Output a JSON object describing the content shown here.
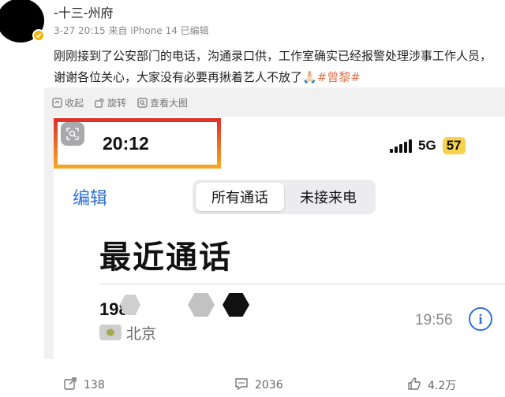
{
  "post": {
    "username": "-十三-州府",
    "meta": "3-27 20:15 来自 iPhone 14 已编辑",
    "text_main": "刚刚接到了公安部门的电话，沟通录口供，工作室确实已经报警处理涉事工作人员，谢谢各位关心，大家没有必要再揪着艺人不放了",
    "emoji": "🙏🏻",
    "hashtag": "#曾黎#"
  },
  "image_toolbar": {
    "collect": "收起",
    "rotate": "旋转",
    "view_large": "查看大图"
  },
  "phone": {
    "time": "20:12",
    "network": "5G",
    "battery": "57",
    "edit": "编辑",
    "segments": [
      "所有通话",
      "未接来电"
    ],
    "title": "最近通话",
    "call": {
      "number_prefix": "198",
      "location": "北京",
      "time": "19:56",
      "info_icon": "i"
    }
  },
  "actions": {
    "share_count": "138",
    "comment_count": "2036",
    "like_count": "4.2万"
  },
  "colors": {
    "accent_blue": "#2f6fd6",
    "hashtag": "#e8704a",
    "highlight_top": "#e0322a",
    "highlight_bottom": "#f5a623",
    "battery": "#f7d24b"
  }
}
